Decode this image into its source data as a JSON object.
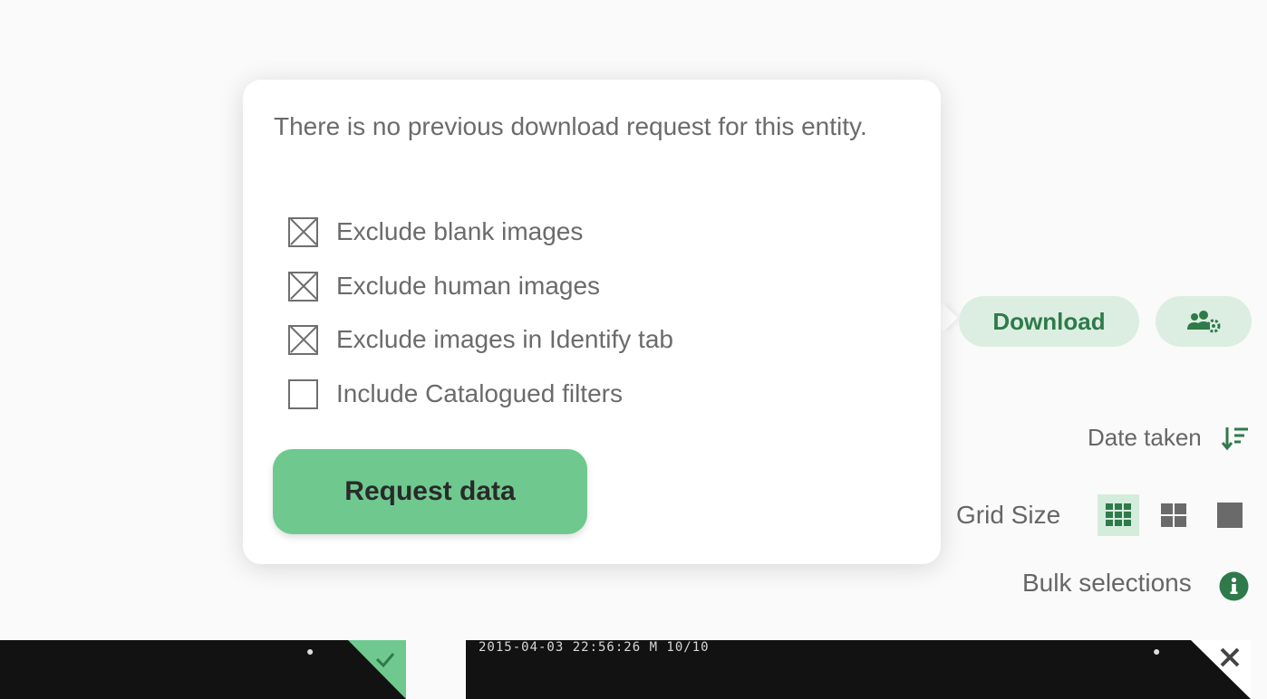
{
  "popover": {
    "message": "There is no previous download request for this entity.",
    "options": [
      {
        "label": "Exclude blank images",
        "checked": true
      },
      {
        "label": "Exclude human images",
        "checked": true
      },
      {
        "label": "Exclude images in Identify tab",
        "checked": true
      },
      {
        "label": "Include Catalogued filters",
        "checked": false
      }
    ],
    "request_label": "Request data"
  },
  "toolbar": {
    "download_label": "Download",
    "users_icon": "users-cog-icon"
  },
  "sort": {
    "label": "Date taken",
    "icon": "sort-descending-icon"
  },
  "grid": {
    "label": "Grid Size",
    "options": [
      "small-grid-icon",
      "medium-grid-icon",
      "large-grid-icon"
    ],
    "active_index": 0
  },
  "bulk": {
    "label": "Bulk selections",
    "icon": "info-icon"
  },
  "thumbnails": [
    {
      "stamp": "",
      "status": "selected",
      "status_icon": "check-icon"
    },
    {
      "stamp": "2015-04-03 22:56:26     M 10/10",
      "status": "excluded",
      "status_icon": "close-icon"
    }
  ],
  "colors": {
    "accent": "#6fc98f",
    "accent_light": "#dceee2",
    "accent_dark": "#2f7a4a"
  }
}
